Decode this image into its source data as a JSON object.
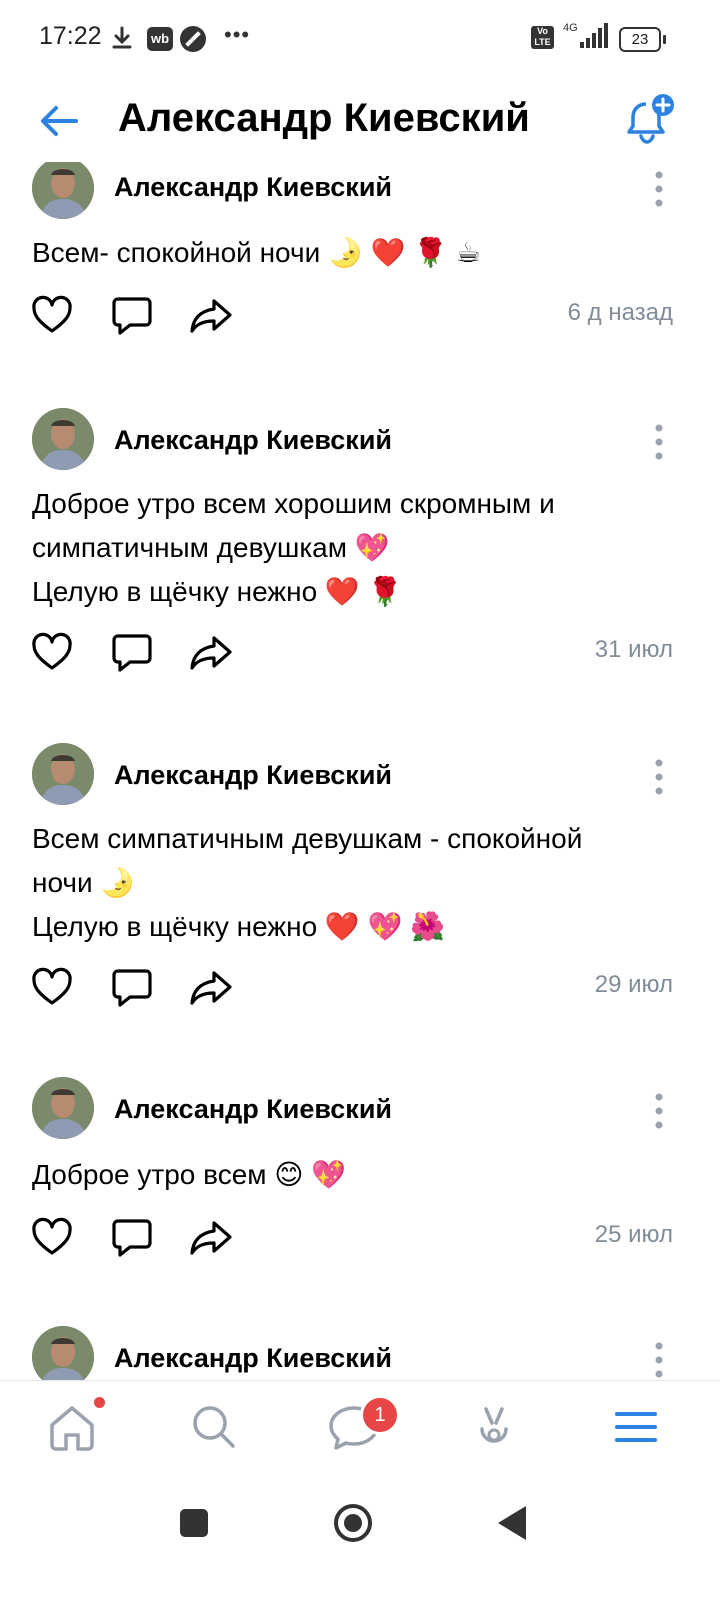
{
  "status_bar": {
    "time": "17:22",
    "wb_label": "wb",
    "more": "•••",
    "volte": "Vo LTE",
    "network": "4G",
    "battery": "23"
  },
  "header": {
    "title": "Александр Киевский"
  },
  "posts": [
    {
      "author": "Александр Киевский",
      "lines": [
        "Всем- спокойной ночи 🌛 ❤️ 🌹 ☕"
      ],
      "date": "6 д назад"
    },
    {
      "author": "Александр Киевский",
      "lines": [
        "Доброе утро всем хорошим скромным и",
        "симпатичным девушкам 💖",
        "Целую в щёчку нежно ❤️ 🌹"
      ],
      "date": "31 июл"
    },
    {
      "author": "Александр Киевский",
      "lines": [
        "Всем симпатичным девушкам - спокойной",
        "ночи 🌛",
        "Целую в щёчку нежно ❤️ 💖 🌺"
      ],
      "date": "29 июл"
    },
    {
      "author": "Александр Киевский",
      "lines": [
        "Доброе утро всем 😊 💖"
      ],
      "date": "25 июл"
    },
    {
      "author": "Александр Киевский",
      "lines": [],
      "date": ""
    }
  ],
  "bottom_nav": {
    "messages_badge": "1"
  },
  "colors": {
    "accent": "#2d81e0",
    "date_gray": "#818c99",
    "icon_gray": "#99a2ad",
    "badge_red": "#e64646"
  }
}
